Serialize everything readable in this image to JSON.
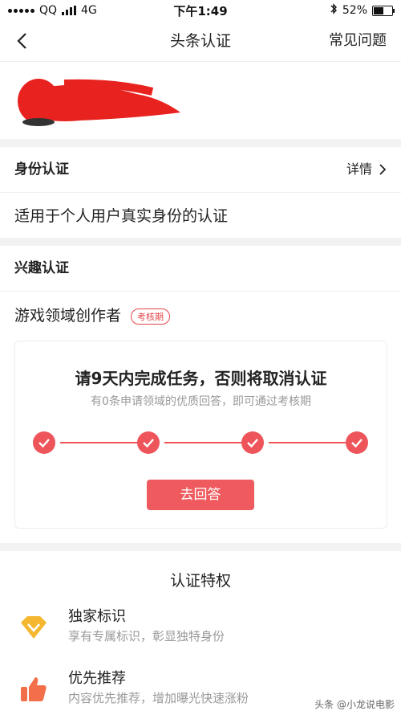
{
  "status_bar": {
    "carrier": "QQ",
    "network": "4G",
    "time": "下午1:49",
    "battery": "52%",
    "battery_level": 0.52
  },
  "nav": {
    "title": "头条认证",
    "right_label": "常见问题"
  },
  "identity": {
    "title": "身份认证",
    "details_label": "详情",
    "description": "适用于个人用户真实身份的认证"
  },
  "interest": {
    "title": "兴趣认证",
    "role": "游戏领域创作者",
    "badge": "考核期"
  },
  "task": {
    "title": "请9天内完成任务，否则将取消认证",
    "subtitle": "有0条申请领域的优质回答，即可通过考核期",
    "steps_completed": 4,
    "steps_total": 4,
    "button_label": "去回答"
  },
  "privileges": {
    "title": "认证特权",
    "items": [
      {
        "name": "独家标识",
        "desc": "享有专属标识，彰显独特身份",
        "icon": "diamond-icon",
        "color": "#f5b730"
      },
      {
        "name": "优先推荐",
        "desc": "内容优先推荐，增加曝光快速涨粉",
        "icon": "thumbs-up-icon",
        "color": "#f26f4a"
      }
    ]
  },
  "watermark": "头条 @小龙说电影",
  "colors": {
    "accent": "#ee555a",
    "divider": "#f2f2f2",
    "muted": "#999999"
  }
}
